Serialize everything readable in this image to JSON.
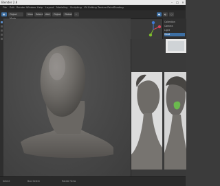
{
  "window": {
    "title": "Blender 2.8"
  },
  "menubar": {
    "items": [
      "File",
      "Edit",
      "Render",
      "Window",
      "Help",
      "Layout",
      "Modeling",
      "Sculpting",
      "UV Editing",
      "Texture Paint",
      "Shading"
    ]
  },
  "header": {
    "mode": "Object Mode",
    "view": "View",
    "select": "Select",
    "add": "Add",
    "object": "Object",
    "global": "Global"
  },
  "right_panel": {
    "rows": [
      "Collection",
      "Camera",
      "Light",
      "Head"
    ]
  },
  "status": {
    "left": "Select",
    "middle": "Box Select",
    "right": "Rotate View"
  },
  "colors": {
    "accent": "#3d6fa3",
    "background": "#3b3b3b",
    "gizmo_x": "#d9435a",
    "gizmo_y": "#7fbe2b",
    "gizmo_z": "#3f7ad8"
  }
}
